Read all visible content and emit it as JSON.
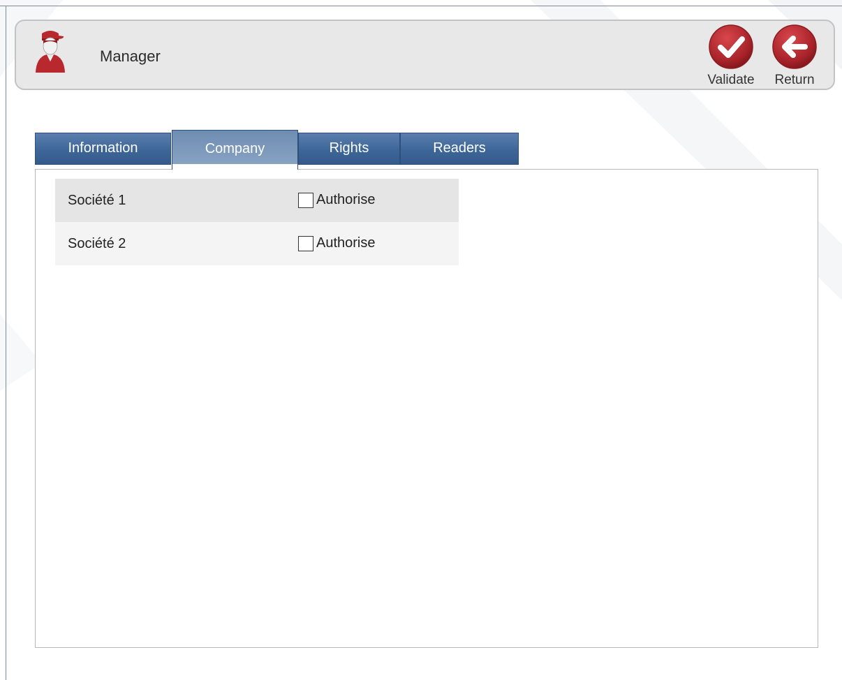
{
  "header": {
    "title": "Manager",
    "validate_label": "Validate",
    "return_label": "Return",
    "user_icon": "user-icon",
    "validate_icon": "check-icon",
    "return_icon": "arrow-left-icon"
  },
  "tabs": [
    {
      "label": "Information",
      "active": false
    },
    {
      "label": "Company",
      "active": true
    },
    {
      "label": "Rights",
      "active": false
    },
    {
      "label": "Readers",
      "active": false
    }
  ],
  "companies": [
    {
      "name": "Société 1",
      "authorise_label": "Authorise",
      "checked": false
    },
    {
      "name": "Société 2",
      "authorise_label": "Authorise",
      "checked": false
    }
  ],
  "colors": {
    "accent_red": "#b52a2f",
    "tab_blue": "#3d6698",
    "tab_active": "#7d98b9",
    "header_bg": "#e8e8e8"
  }
}
